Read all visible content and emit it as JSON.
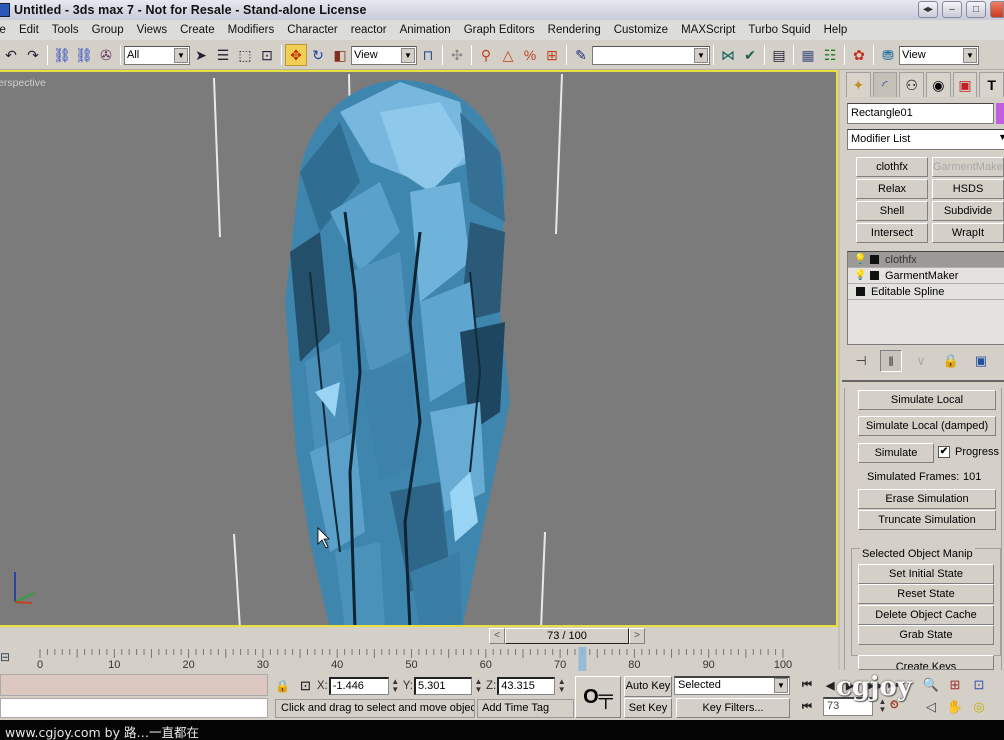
{
  "window": {
    "title": "Untitled  - 3ds max 7  - Not for Resale - Stand-alone License",
    "buttons": {
      "restore_label": "◂▸",
      "minimize_label": "–",
      "maximize_label": "□",
      "close_label": ""
    }
  },
  "menu": {
    "items": [
      "le",
      "Edit",
      "Tools",
      "Group",
      "Views",
      "Create",
      "Modifiers",
      "Character",
      "reactor",
      "Animation",
      "Graph Editors",
      "Rendering",
      "Customize",
      "MAXScript",
      "Turbo Squid",
      "Help"
    ]
  },
  "toolbar": {
    "undo_icon": "↶",
    "redo_icon": "↷",
    "link_icon": "⛓",
    "unlink_icon": "⛓",
    "bind_space_warp_icon": "✇",
    "selection_filter": "All",
    "select_icon": "➤",
    "select_by_name_icon": "☰",
    "rect_region_icon": "⬚",
    "window_crossing_icon": "⊡",
    "move_icon": "✥",
    "rotate_icon": "↻",
    "scale_icon": "◧",
    "ref_coord_system": "View",
    "pivot_icon": "⊓",
    "snap_icons": [
      "✣",
      "⚲",
      "△",
      "%",
      "⊞"
    ],
    "named_selection_icon": "✎",
    "named_selection_set": "",
    "mirror_icon": "⋈",
    "align_icon": "✔",
    "layer_icon": "▤",
    "curve_editor_icon": "▦",
    "schematic_icon": "☷",
    "material_editor_icon": "✿",
    "render_scene_icon": "⛃",
    "render_type": "View"
  },
  "viewport": {
    "label": "erspective",
    "cloth_color": "#4a9ac8",
    "highlight_color": "#e8e040"
  },
  "command_panel": {
    "tabs": [
      {
        "name": "create",
        "icon": "✦"
      },
      {
        "name": "modify",
        "icon": "◜"
      },
      {
        "name": "hierarchy",
        "icon": "⚇"
      },
      {
        "name": "motion",
        "icon": "◉"
      },
      {
        "name": "display",
        "icon": "▣"
      },
      {
        "name": "utilities",
        "icon": "T"
      }
    ],
    "object_name": "Rectangle01",
    "object_color": "#c060e0",
    "modifier_list": "Modifier List",
    "modifier_buttons": [
      {
        "label": "clothfx",
        "enabled": true
      },
      {
        "label": "GarmentMaker",
        "enabled": false
      },
      {
        "label": "Relax",
        "enabled": true
      },
      {
        "label": "HSDS",
        "enabled": true
      },
      {
        "label": "Shell",
        "enabled": true
      },
      {
        "label": "Subdivide",
        "enabled": true
      },
      {
        "label": "Intersect",
        "enabled": true
      },
      {
        "label": "WrapIt",
        "enabled": true
      }
    ],
    "stack": [
      {
        "label": "clothfx",
        "selected": true,
        "bulb": true
      },
      {
        "label": "GarmentMaker",
        "selected": false,
        "bulb": true
      },
      {
        "label": "Editable Spline",
        "selected": false,
        "bulb": false
      }
    ],
    "stack_tools": {
      "pin_icon": "⊣",
      "show_end_icon": "‖",
      "make_unique_icon": "∨",
      "remove_modifier_icon": "🔒",
      "configure_sets_icon": "▣"
    },
    "rollout": {
      "simulate_local": "Simulate Local",
      "simulate_local_damped": "Simulate Local (damped)",
      "simulate": "Simulate",
      "progress_label": "Progress",
      "progress_checked": true,
      "simulated_frames_label": "Simulated Frames:",
      "simulated_frames_value": "101",
      "erase_simulation": "Erase Simulation",
      "truncate_simulation": "Truncate Simulation",
      "manip_group_title": "Selected Object Manip",
      "set_initial_state": "Set Initial State",
      "reset_state": "Reset State",
      "delete_object_cache": "Delete Object Cache",
      "grab_state": "Grab State",
      "create_keys": "Create Keys"
    }
  },
  "timeline": {
    "current_frame": 73,
    "total_frames": 100,
    "slider_label": "73 / 100",
    "prev_label": "<",
    "next_label": ">",
    "ticks": [
      0,
      10,
      20,
      30,
      40,
      50,
      60,
      70,
      80,
      90,
      100
    ]
  },
  "status": {
    "lock_icon": "🔒",
    "absolute_mode_icon": "⊡",
    "x_label": "X:",
    "x_value": "-1.446",
    "y_label": "Y:",
    "y_value": "5.301",
    "z_label": "Z:",
    "z_value": "43.315",
    "prompt": "Click and drag to select and move objec",
    "add_time_tag": "Add Time Tag",
    "key_icon": "O╤",
    "auto_key": "Auto Key",
    "set_key": "Set Key",
    "key_mode": "Selected",
    "key_filters": "Key Filters...",
    "frame_value": "73"
  },
  "playback": {
    "go_start_icon": "⏮",
    "prev_frame_icon": "◀",
    "play_icon": "▶",
    "next_frame_icon": "▶▶",
    "go_end_icon": "⏭",
    "key_mode_icon": "⏮",
    "time_config_icon": "⏲"
  },
  "nav": {
    "zoom_icon": "🔍",
    "zoom_all_icon": "⊞",
    "zoom_extents_icon": "⊡",
    "fov_icon": "◁",
    "pan_icon": "✋",
    "orbit_icon": "◎"
  },
  "watermark": {
    "logo": "cgjoy",
    "caption": "www.cgjoy.com by 路…一直都在"
  }
}
